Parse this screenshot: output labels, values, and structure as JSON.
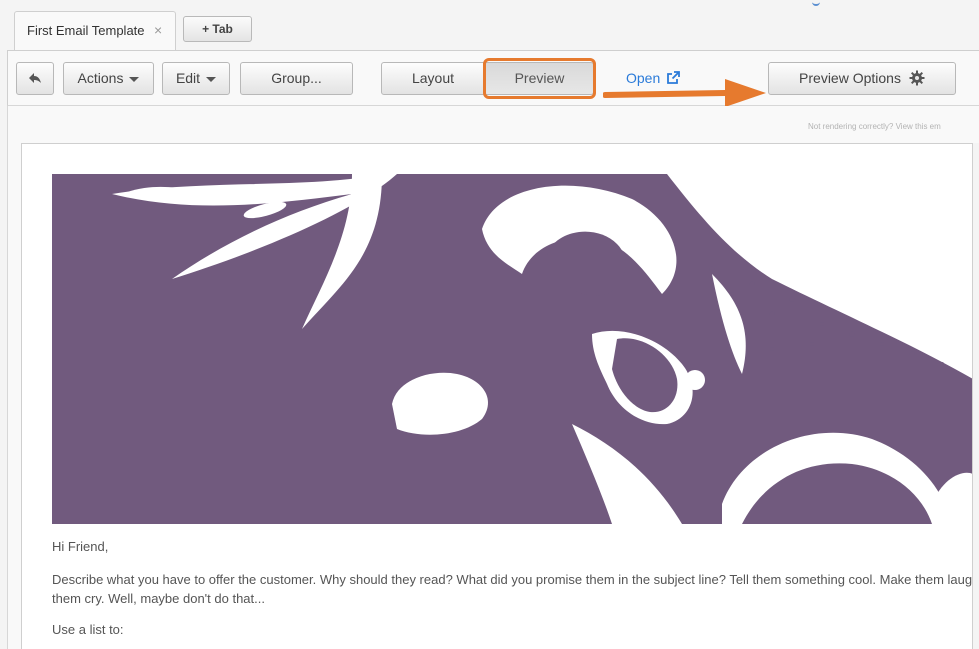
{
  "tabs": {
    "active_label": "First Email Template",
    "close_glyph": "×",
    "add_tab_label": "+ Tab"
  },
  "toolbar": {
    "back_icon": "back-arrow-icon",
    "actions_label": "Actions",
    "edit_label": "Edit",
    "group_label": "Group...",
    "layout_label": "Layout",
    "preview_label": "Preview",
    "open_label": "Open",
    "open_icon": "external-link-icon",
    "preview_options_label": "Preview Options",
    "preview_options_icon": "gear-icon"
  },
  "annotation": {
    "highlight_color": "#e67a2e",
    "arrow_color": "#e67a2e"
  },
  "preview": {
    "notice": "Not rendering correctly? View this em",
    "hero_color": "#715a7e",
    "greeting": "Hi Friend,",
    "body": "Describe what you have to offer the customer. Why should they read? What did you promise them in the subject line? Tell them something cool. Make them laug\nthem cry. Well, maybe don't do that...",
    "list_intro": "Use a list to:"
  }
}
